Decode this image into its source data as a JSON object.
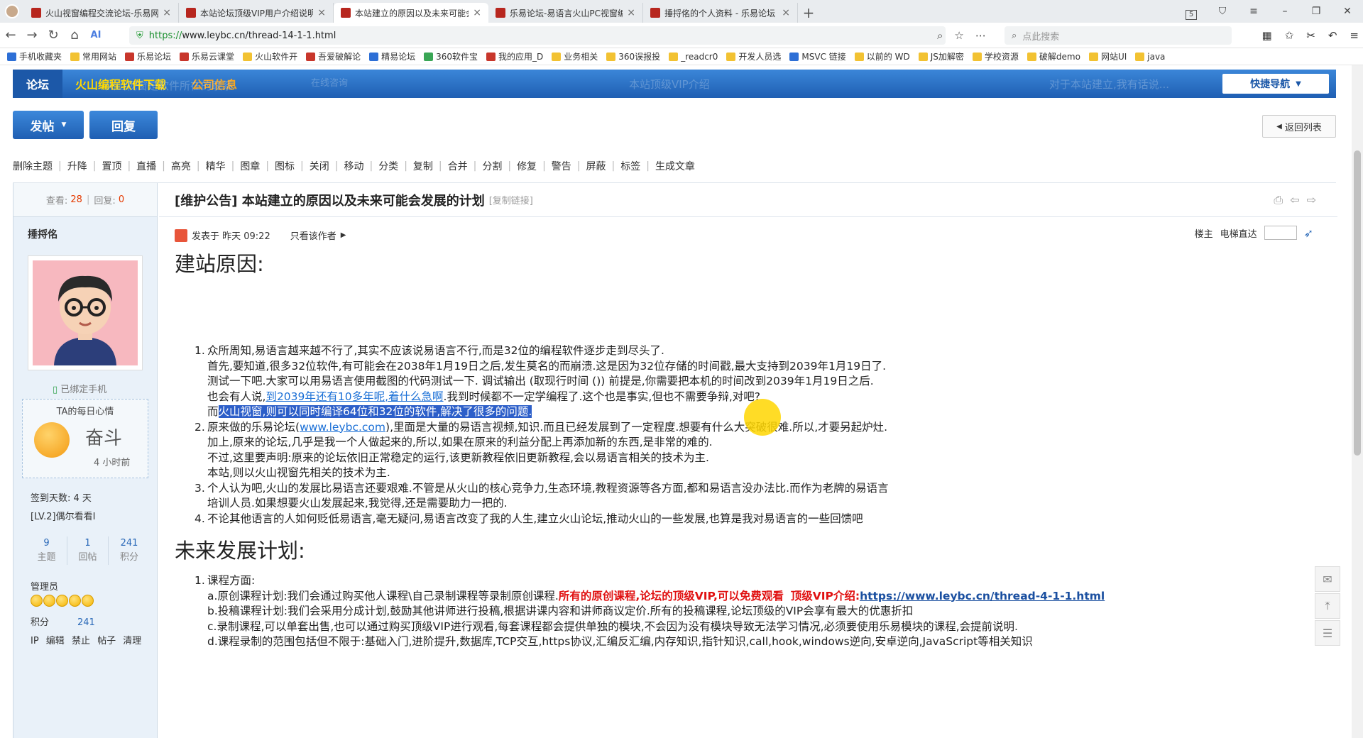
{
  "browser": {
    "tabs": [
      {
        "title": "火山视窗编程交流论坛-乐易网"
      },
      {
        "title": "本站论坛顶级VIP用户介绍说明"
      },
      {
        "title": "本站建立的原因以及未来可能会发展"
      },
      {
        "title": "乐易论坛-易语言火山PC视窗编程"
      },
      {
        "title": "捶捋佲的个人资料 - 乐易论坛"
      }
    ],
    "window_badge": "5",
    "url_scheme": "https://",
    "url_rest": "www.leybc.cn/thread-14-1-1.html",
    "search_placeholder": "点此搜索",
    "bookmarks": [
      "手机收藏夹",
      "常用网站",
      "乐易论坛",
      "乐易云课堂",
      "火山软件开",
      "吾爱破解论",
      "精易论坛",
      "360软件宝",
      "我的应用_D",
      "业务相关",
      "360误报投",
      "_readcr0",
      "开发人员选",
      "MSVC 链接",
      "以前的 WD",
      "JS加解密",
      "学校资源",
      "破解demo",
      "网站UI",
      "java"
    ]
  },
  "forum_nav": {
    "home": "论坛",
    "items": [
      "火山编程软件下载",
      "公司信息"
    ],
    "ghost_left": "火山视窗是软件所在的联系",
    "ghost_online": "在线咨询",
    "ghost_mid": "本站顶级VIP介绍",
    "ghost_right": "对于本站建立,我有话说...",
    "quick_nav": "快捷导航"
  },
  "actions": {
    "post": "发帖",
    "reply": "回复",
    "back_to_list": "返回列表"
  },
  "mod_tools": [
    "删除主题",
    "升降",
    "置顶",
    "直播",
    "高亮",
    "精华",
    "图章",
    "图标",
    "关闭",
    "移动",
    "分类",
    "复制",
    "合并",
    "分割",
    "修复",
    "警告",
    "屏蔽",
    "标签",
    "生成文章"
  ],
  "stats": {
    "views_label": "查看:",
    "views": "28",
    "replies_label": "回复:",
    "replies": "0"
  },
  "author": {
    "name": "捶捋佲",
    "phone_bound": "已绑定手机",
    "mood_title": "TA的每日心情",
    "mood": "奋斗",
    "mood_time": "4 小时前",
    "checkin_days": "签到天数: 4 天",
    "level": "[LV.2]偶尔看看I",
    "topics": "9",
    "topics_label": "主题",
    "posts": "1",
    "posts_label": "回帖",
    "credits": "241",
    "credits_label": "积分",
    "group": "管理员",
    "points_label": "积分",
    "points": "241",
    "admin_links": "IP 编辑 禁止 帖子 清理"
  },
  "post": {
    "title": "[维护公告] 本站建立的原因以及未来可能会发展的计划",
    "copy_link": "[复制链接]",
    "posted": "发表于 昨天 09:22",
    "only_author": "只看该作者",
    "floor": "楼主",
    "elevator": "电梯直达",
    "h_reason": "建站原因:",
    "reason_items": [
      {
        "n": "1.",
        "lines": [
          "众所周知,易语言越来越不行了,其实不应该说易语言不行,而是32位的编程软件逐步走到尽头了.",
          "首先,要知道,很多32位软件,有可能会在2038年1月19日之后,发生莫名的而崩溃.这是因为32位存储的时间戳,最大支持到2039年1月19日了.",
          "测试一下吧.大家可以用易语言使用截图的代码测试一下. 调试输出 (取现行时间 ()) 前提是,你需要把本机的时间改到2039年1月19日之后."
        ]
      },
      {
        "n": "2.",
        "lines": [
          "里面是大量的易语言视频,知识.而且已经发展到了一定程度.想要有什么大突破很难.所以,才要另起炉灶.",
          "加上,原来的论坛,几乎是我一个人做起来的,所以,如果在原来的利益分配上再添加新的东西,是非常的难的.",
          "不过,这里要声明:原来的论坛依旧正常稳定的运行,该更新教程依旧更新教程,会以易语言相关的技术为主.",
          "本站,则以火山视窗先相关的技术为主."
        ]
      },
      {
        "n": "3.",
        "lines": [
          "个人认为吧,火山的发展比易语言还要艰难.不管是从火山的核心竞争力,生态环境,教程资源等各方面,都和易语言没办法比.而作为老牌的易语言",
          "培训人员.如果想要火山发展起来,我觉得,还是需要助力一把的."
        ]
      },
      {
        "n": "4.",
        "lines": [
          "不论其他语言的人如何贬低易语言,毫无疑问,易语言改变了我的人生,建立火山论坛,推动火山的一些发展,也算是我对易语言的一些回馈吧"
        ]
      }
    ],
    "line1d_pre": "也会有人说,",
    "line1d_link": "到2039年还有10多年呢,着什么急啊",
    "line1d_post": ".我到时候都不一定学编程了.这个也是事实,但也不需要争辩,对吧?",
    "line1e_pre": "而",
    "line1e_sel": "火山视窗,则可以同时编译64位和32位的软件,解决了很多的问题.",
    "line2_pre": "原来做的乐易论坛(",
    "line2_link": "www.leybc.com",
    "line2_post": "),",
    "h_future": "未来发展计划:",
    "future_n": "1.",
    "future_head": "课程方面:",
    "future_a_pre": "a.原创课程计划:我们会通过购买他人课程\\自己录制课程等录制原创课程.",
    "future_a_red": "所有的原创课程,论坛的顶级VIP,可以免费观看",
    "future_a_red2": "顶级VIP介绍:",
    "future_a_link": "https://www.leybc.cn/thread-4-1-1.html",
    "future_b": "b.投稿课程计划:我们会采用分成计划,鼓励其他讲师进行投稿,根据讲课内容和讲师商议定价.所有的投稿课程,论坛顶级的VIP会享有最大的优惠折扣",
    "future_c": "c.录制课程,可以单套出售,也可以通过购买顶级VIP进行观看,每套课程都会提供单独的模块,不会因为没有模块导致无法学习情况,必须要使用乐易模块的课程,会提前说明.",
    "future_d": "d.课程录制的范围包括但不限于:基础入门,进阶提升,数据库,TCP交互,https协议,汇编反汇编,内存知识,指针知识,call,hook,windows逆向,安卓逆向,JavaScript等相关知识"
  }
}
